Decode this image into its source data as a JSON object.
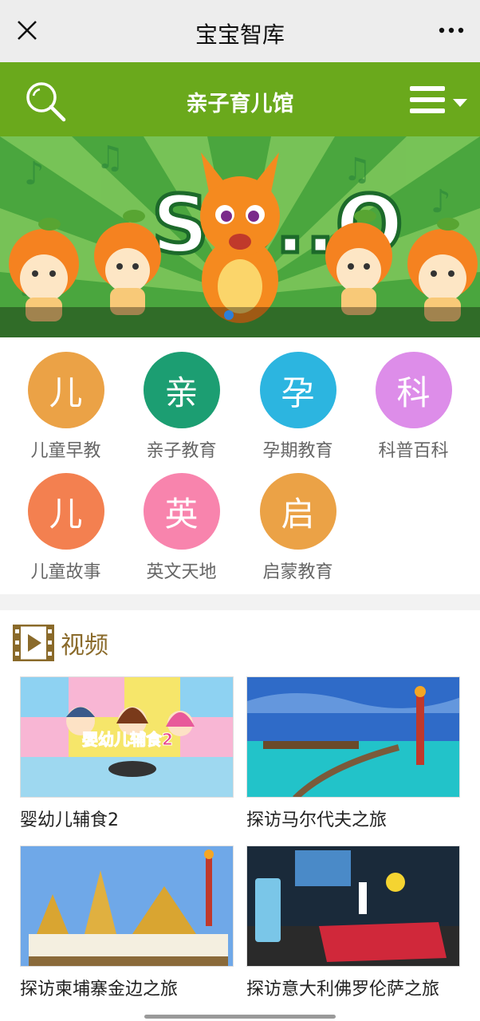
{
  "topbar": {
    "title": "宝宝智库",
    "close_icon": "close-icon",
    "more_icon": "more-dots-icon"
  },
  "header": {
    "title": "亲子育儿馆",
    "search_icon": "search-icon",
    "menu_icon": "hamburger-menu-icon",
    "bg_color": "#6aa91c"
  },
  "banner": {
    "text": "SO..O",
    "active_slide": 1
  },
  "categories": [
    {
      "glyph": "儿",
      "label": "儿童早教",
      "color": "#eba246"
    },
    {
      "glyph": "亲",
      "label": "亲子教育",
      "color": "#1c9e72"
    },
    {
      "glyph": "孕",
      "label": "孕期教育",
      "color": "#2cb5e0"
    },
    {
      "glyph": "科",
      "label": "科普百科",
      "color": "#dd8de9"
    },
    {
      "glyph": "儿",
      "label": "儿童故事",
      "color": "#f38050"
    },
    {
      "glyph": "英",
      "label": "英文天地",
      "color": "#f884ad"
    },
    {
      "glyph": "启",
      "label": "启蒙教育",
      "color": "#eba246"
    }
  ],
  "videos_section": {
    "title": "视频",
    "icon": "film-icon",
    "items": [
      {
        "caption": "婴幼儿辅食2",
        "overlay": "婴幼儿辅食2"
      },
      {
        "caption": "探访马尔代夫之旅"
      },
      {
        "caption": "探访柬埔寨金边之旅"
      },
      {
        "caption": "探访意大利佛罗伦萨之旅"
      }
    ]
  }
}
